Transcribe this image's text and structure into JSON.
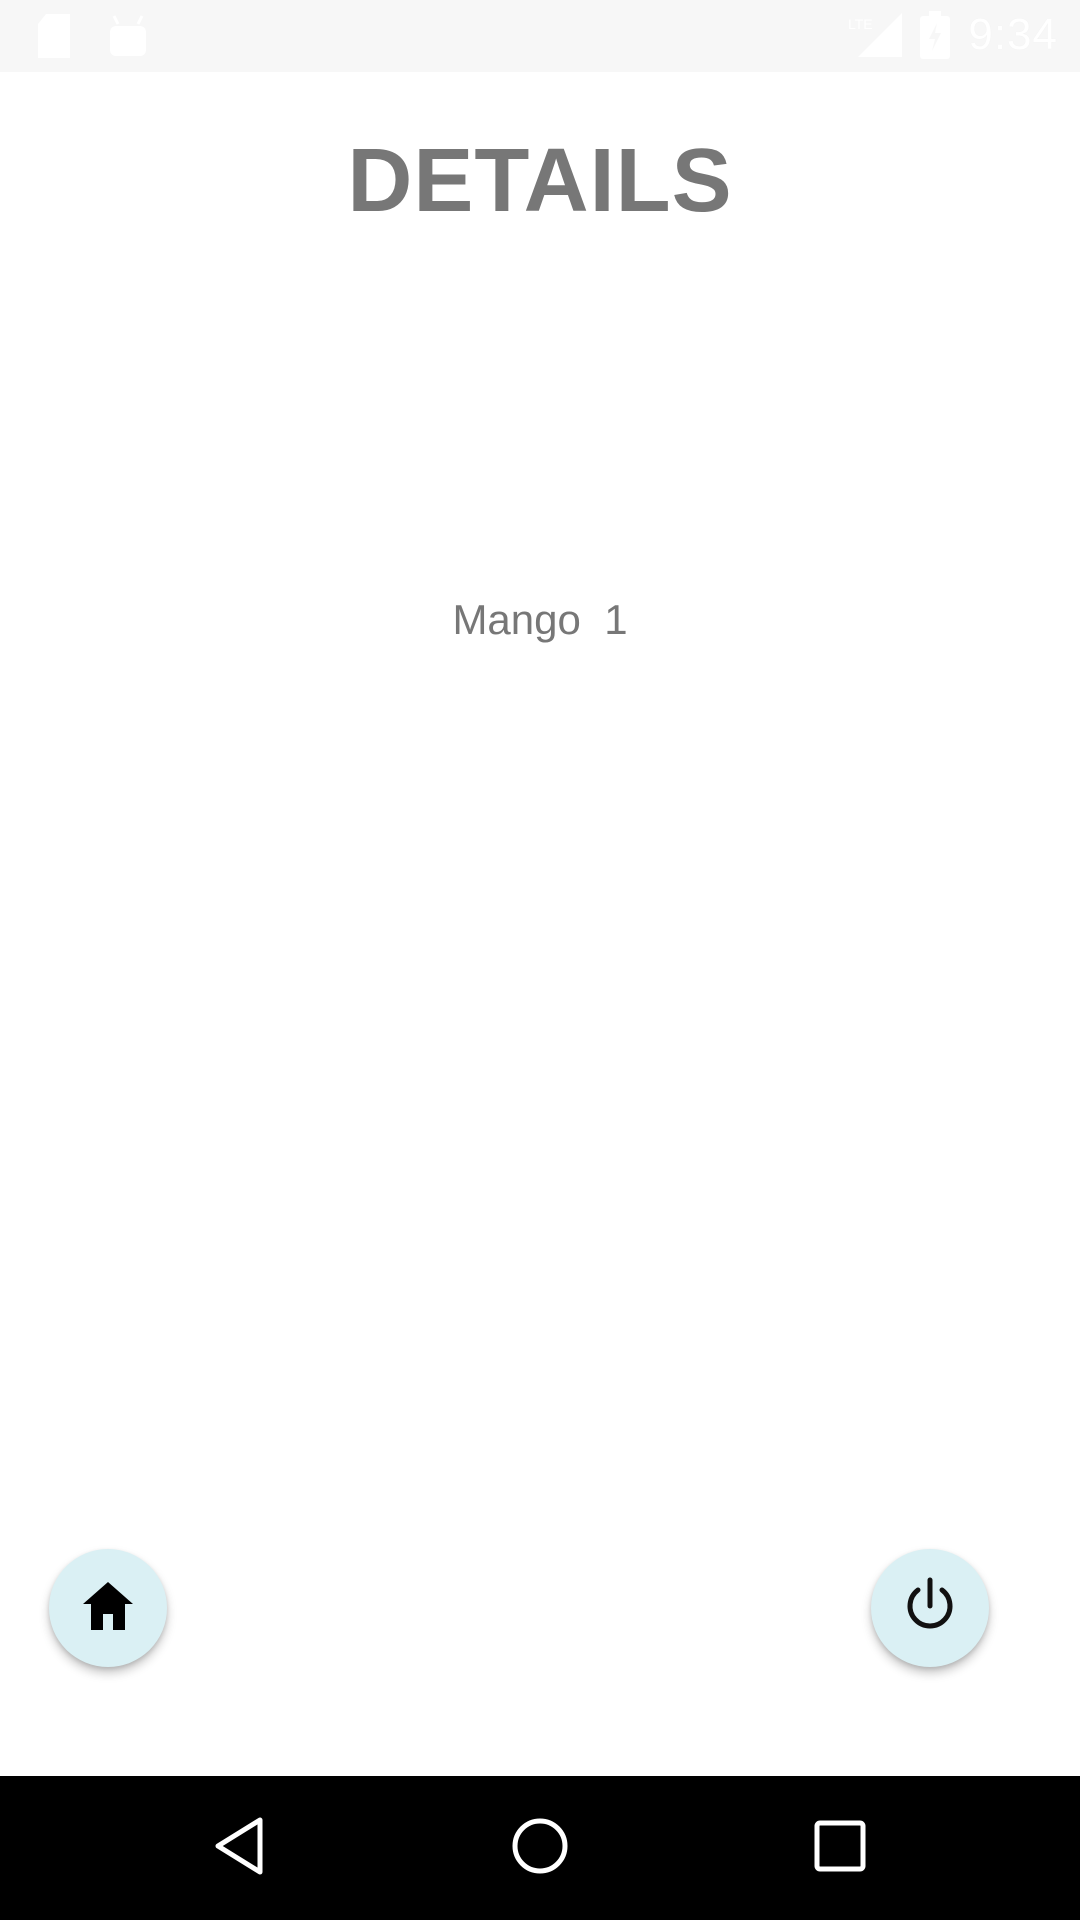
{
  "status_bar": {
    "time": "9:34",
    "icons": [
      "sd-card-icon",
      "android-icon",
      "lte-signal-icon",
      "battery-charging-icon"
    ]
  },
  "page": {
    "title": "DETAILS",
    "detail_text": "Mango  1"
  },
  "fabs": {
    "home_icon": "home-icon",
    "power_icon": "power-icon",
    "background_color": "#daf0f4"
  },
  "nav_bar": {
    "icons": [
      "back-icon",
      "home-circle-icon",
      "recents-icon"
    ]
  },
  "colors": {
    "title_text": "#777777",
    "detail_text": "#777777",
    "nav_bar_bg": "#000000",
    "status_bar_bg": "#f7f7f7"
  }
}
